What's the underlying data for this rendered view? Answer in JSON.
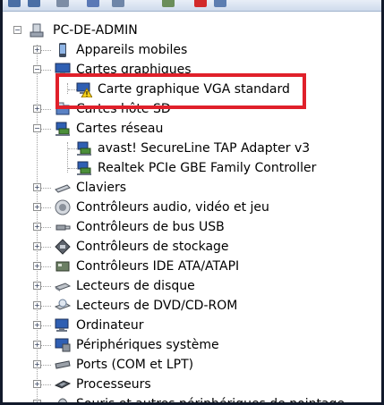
{
  "toolbar": {
    "buttons": [
      {
        "icon": "back-arrow-icon",
        "color": "#4a6fa5"
      },
      {
        "icon": "forward-arrow-icon",
        "color": "#4a6fa5"
      },
      {
        "icon": "properties-icon",
        "color": "#7d8da5"
      },
      {
        "icon": "help-icon",
        "color": "#5b79b6"
      },
      {
        "icon": "scan-hardware-icon",
        "color": "#6f86a8"
      },
      {
        "icon": "update-driver-icon",
        "color": "#6b8e5a"
      },
      {
        "icon": "uninstall-icon",
        "color": "#d22a2a"
      },
      {
        "icon": "disable-icon",
        "color": "#5c7db0"
      }
    ]
  },
  "tree": {
    "root": {
      "label": "PC-DE-ADMIN",
      "icon": "computer-icon"
    },
    "items": [
      {
        "label": "Appareils mobiles",
        "icon": "mobile-device-icon",
        "expander": "+"
      },
      {
        "label": "Cartes graphiques",
        "icon": "display-adapter-icon",
        "expander": "-",
        "children": [
          {
            "label": "Carte graphique VGA standard",
            "icon": "display-adapter-warning-icon"
          }
        ]
      },
      {
        "label": "Cartes hôte SD",
        "icon": "sd-host-icon",
        "expander": "+"
      },
      {
        "label": "Cartes réseau",
        "icon": "network-adapter-icon",
        "expander": "-",
        "children": [
          {
            "label": "avast! SecureLine TAP Adapter v3",
            "icon": "network-adapter-icon"
          },
          {
            "label": "Realtek PCIe GBE Family Controller",
            "icon": "network-adapter-icon"
          }
        ]
      },
      {
        "label": "Claviers",
        "icon": "keyboard-icon",
        "expander": "+"
      },
      {
        "label": "Contrôleurs audio, vidéo et jeu",
        "icon": "speaker-icon",
        "expander": "+"
      },
      {
        "label": "Contrôleurs de bus USB",
        "icon": "usb-icon",
        "expander": "+"
      },
      {
        "label": "Contrôleurs de stockage",
        "icon": "storage-controller-icon",
        "expander": "+"
      },
      {
        "label": "Contrôleurs IDE ATA/ATAPI",
        "icon": "ide-controller-icon",
        "expander": "+"
      },
      {
        "label": "Lecteurs de disque",
        "icon": "disk-drive-icon",
        "expander": "+"
      },
      {
        "label": "Lecteurs de DVD/CD-ROM",
        "icon": "dvd-drive-icon",
        "expander": "+"
      },
      {
        "label": "Ordinateur",
        "icon": "computer-icon",
        "expander": "+"
      },
      {
        "label": "Périphériques système",
        "icon": "system-device-icon",
        "expander": "+"
      },
      {
        "label": "Ports (COM et LPT)",
        "icon": "port-icon",
        "expander": "+"
      },
      {
        "label": "Processeurs",
        "icon": "processor-icon",
        "expander": "+"
      },
      {
        "label": "Souris et autres périphériques de pointage",
        "icon": "mouse-icon",
        "expander": "+"
      }
    ]
  },
  "annotation": {
    "color": "#e0202a"
  }
}
